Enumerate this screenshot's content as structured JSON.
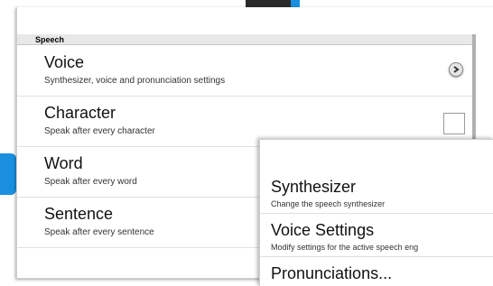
{
  "settings": {
    "section_header": "Speech",
    "rows": [
      {
        "title": "Voice",
        "subtitle": "Synthesizer, voice and pronunciation settings",
        "control": "chevron-right-icon"
      },
      {
        "title": "Character",
        "subtitle": "Speak after every character",
        "control": "checkbox",
        "checked": false
      },
      {
        "title": "Word",
        "subtitle": "Speak after every word"
      },
      {
        "title": "Sentence",
        "subtitle": "Speak after every sentence"
      }
    ]
  },
  "popup": {
    "items": [
      {
        "title": "Synthesizer",
        "subtitle": "Change the speech synthesizer"
      },
      {
        "title": "Voice Settings",
        "subtitle": "Modify settings for the active speech eng"
      },
      {
        "title": "Pronunciations..."
      }
    ]
  },
  "colors": {
    "background_accent": "#1a8fe0",
    "header_bg": "#e8e8e8"
  }
}
